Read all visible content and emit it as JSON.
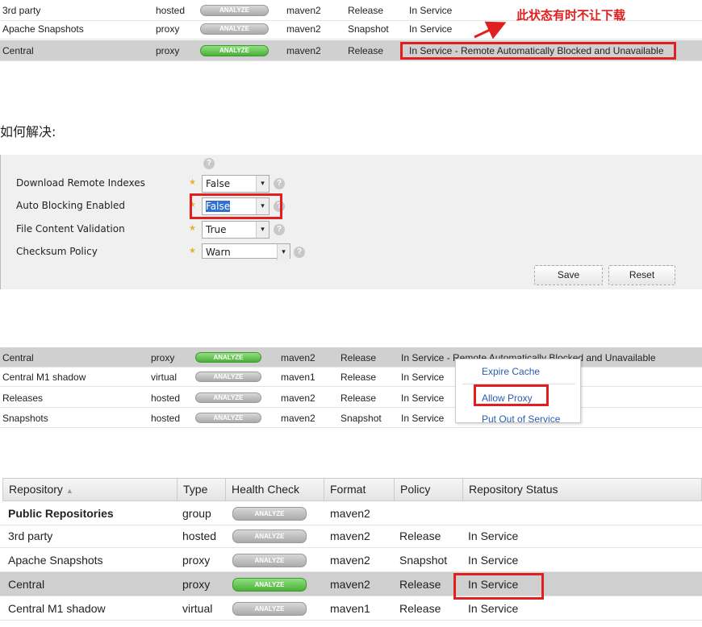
{
  "columns": [
    "Repository",
    "Type",
    "Health Check",
    "Format",
    "Policy",
    "Repository Status"
  ],
  "analyze_label": "ANALYZE",
  "section1": {
    "rows": [
      {
        "name": "3rd party",
        "type": "hosted",
        "format": "maven2",
        "policy": "Release",
        "status": "In Service",
        "active": false,
        "selected": false
      },
      {
        "name": "Apache Snapshots",
        "type": "proxy",
        "format": "maven2",
        "policy": "Snapshot",
        "status": "In Service",
        "active": false,
        "selected": false
      },
      {
        "name": "Central",
        "type": "proxy",
        "format": "maven2",
        "policy": "Release",
        "status": "In Service - Remote Automatically Blocked and Unavailable",
        "active": true,
        "selected": true
      }
    ],
    "annotation": "此状态有时不让下载"
  },
  "how_to_fix": "如何解决:",
  "settings": {
    "fields": [
      {
        "label": "Download Remote Indexes",
        "value": "False"
      },
      {
        "label": "Auto Blocking Enabled",
        "value": "False"
      },
      {
        "label": "File Content Validation",
        "value": "True"
      },
      {
        "label": "Checksum Policy",
        "value": "Warn"
      }
    ],
    "save": "Save",
    "reset": "Reset"
  },
  "section3": {
    "rows": [
      {
        "name": "Central",
        "type": "proxy",
        "format": "maven2",
        "policy": "Release",
        "status": "In Service - Remote Automatically Blocked and Unavailable",
        "active": true,
        "selected": true
      },
      {
        "name": "Central M1 shadow",
        "type": "virtual",
        "format": "maven1",
        "policy": "Release",
        "status": "In Service",
        "active": false,
        "selected": false
      },
      {
        "name": "Releases",
        "type": "hosted",
        "format": "maven2",
        "policy": "Release",
        "status": "In Service",
        "active": false,
        "selected": false
      },
      {
        "name": "Snapshots",
        "type": "hosted",
        "format": "maven2",
        "policy": "Snapshot",
        "status": "In Service",
        "active": false,
        "selected": false
      }
    ],
    "menu": [
      "Expire Cache",
      "Allow Proxy",
      "Put Out of Service"
    ]
  },
  "section4": {
    "rows": [
      {
        "name": "Public Repositories",
        "type": "group",
        "format": "maven2",
        "policy": "",
        "status": "",
        "active": false,
        "selected": false,
        "bold": true
      },
      {
        "name": "3rd party",
        "type": "hosted",
        "format": "maven2",
        "policy": "Release",
        "status": "In Service",
        "active": false,
        "selected": false
      },
      {
        "name": "Apache Snapshots",
        "type": "proxy",
        "format": "maven2",
        "policy": "Snapshot",
        "status": "In Service",
        "active": false,
        "selected": false
      },
      {
        "name": "Central",
        "type": "proxy",
        "format": "maven2",
        "policy": "Release",
        "status": "In Service",
        "active": true,
        "selected": true
      },
      {
        "name": "Central M1 shadow",
        "type": "virtual",
        "format": "maven1",
        "policy": "Release",
        "status": "In Service",
        "active": false,
        "selected": false
      }
    ]
  },
  "colors": {
    "annotation": "#e02020",
    "selected_row": "#d0d0d0",
    "analyze_active": "#4caf3a",
    "link": "#2a5db0"
  }
}
